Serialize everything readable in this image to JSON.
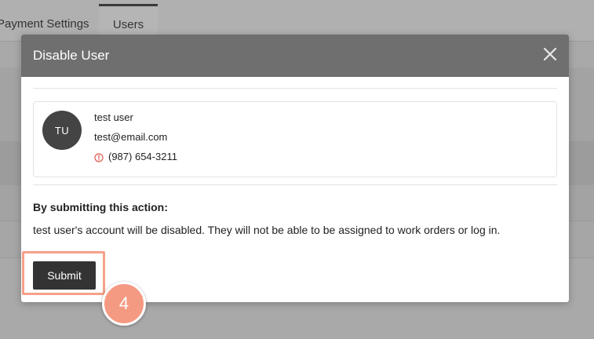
{
  "background": {
    "tabs": [
      {
        "label": "Payment Settings"
      },
      {
        "label": "Users"
      }
    ]
  },
  "modal": {
    "title": "Disable User",
    "close_icon": "close-icon",
    "user": {
      "initials": "TU",
      "name": "test user",
      "email": "test@email.com",
      "phone": "(987) 654-3211",
      "phone_status_icon": "warning-circle-icon"
    },
    "notice_heading": "By submitting this action:",
    "notice_body": "test user's account will be disabled. They will not be able to be assigned to work orders or log in.",
    "submit_label": "Submit"
  },
  "annotation": {
    "step_number": "4",
    "highlight_color": "#f6a08a",
    "badge_color": "#f59a82"
  },
  "colors": {
    "header_bg": "#6f6f6f",
    "button_bg": "#333333",
    "avatar_bg": "#444444",
    "warning_red": "#e05a4f"
  }
}
